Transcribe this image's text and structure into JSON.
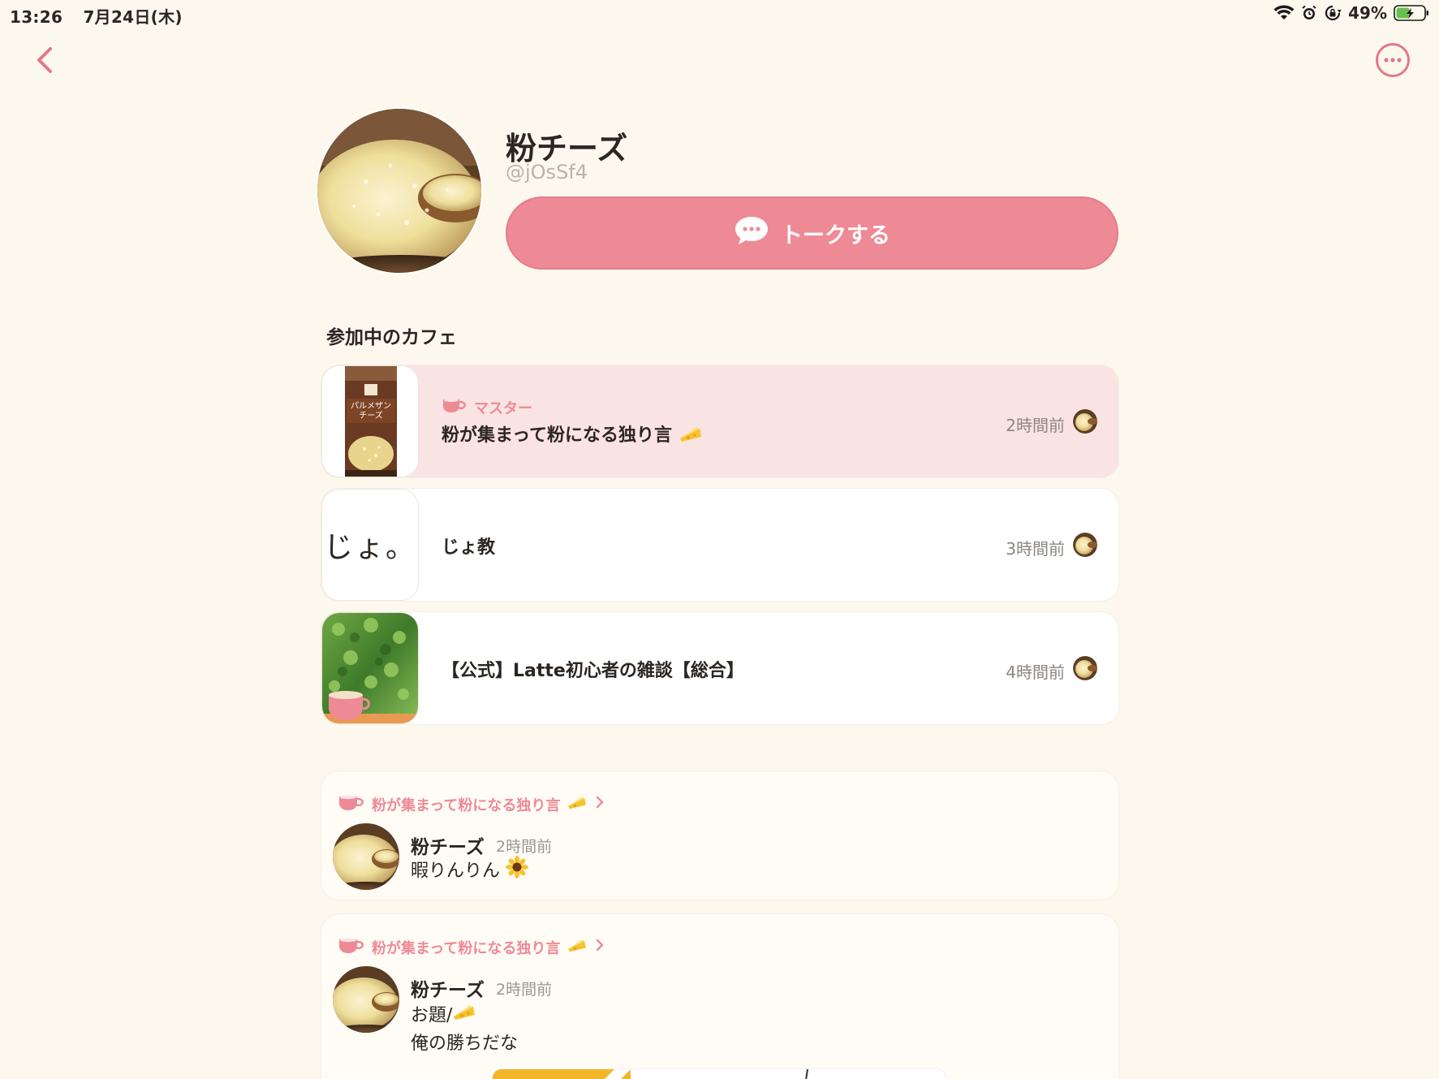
{
  "status_bar": {
    "time": "13:26",
    "date": "7月24日(木)",
    "battery_percent": "49%",
    "battery_level": 0.49,
    "icons": [
      "wifi-icon",
      "alarm-icon",
      "rotation-lock-icon",
      "battery-icon"
    ]
  },
  "nav": {
    "back_icon": "chevron-left-icon",
    "more_icon": "more-options-icon"
  },
  "profile": {
    "name": "粉チーズ",
    "handle": "@jOsSf4",
    "talk_button_label": "トークする",
    "talk_icon": "chat-bubble-icon"
  },
  "cafes": {
    "section_title": "参加中のカフェ",
    "items": [
      {
        "name": "粉が集まって粉になる独り言",
        "role": "マスター",
        "time": "2時間前",
        "thumb": "parmesan-can",
        "highlighted": true
      },
      {
        "name": "じょ教",
        "time": "3時間前",
        "thumb_text": "じょ。"
      },
      {
        "name": "【公式】Latte初心者の雑談【総合】",
        "time": "4時間前",
        "thumb": "green-leaves-cup"
      }
    ]
  },
  "posts": [
    {
      "cafe": "粉が集まって粉になる独り言",
      "author": "粉チーズ",
      "time": "2時間前",
      "text": "暇りんりん"
    },
    {
      "cafe": "粉が集まって粉になる独り言",
      "author": "粉チーズ",
      "time": "2時間前",
      "line1": "お題/",
      "line2": "俺の勝ちだな"
    }
  ],
  "colors": {
    "accent": "#ee8a95",
    "background": "#fdf8ee",
    "highlight_row": "#fae3e3"
  }
}
